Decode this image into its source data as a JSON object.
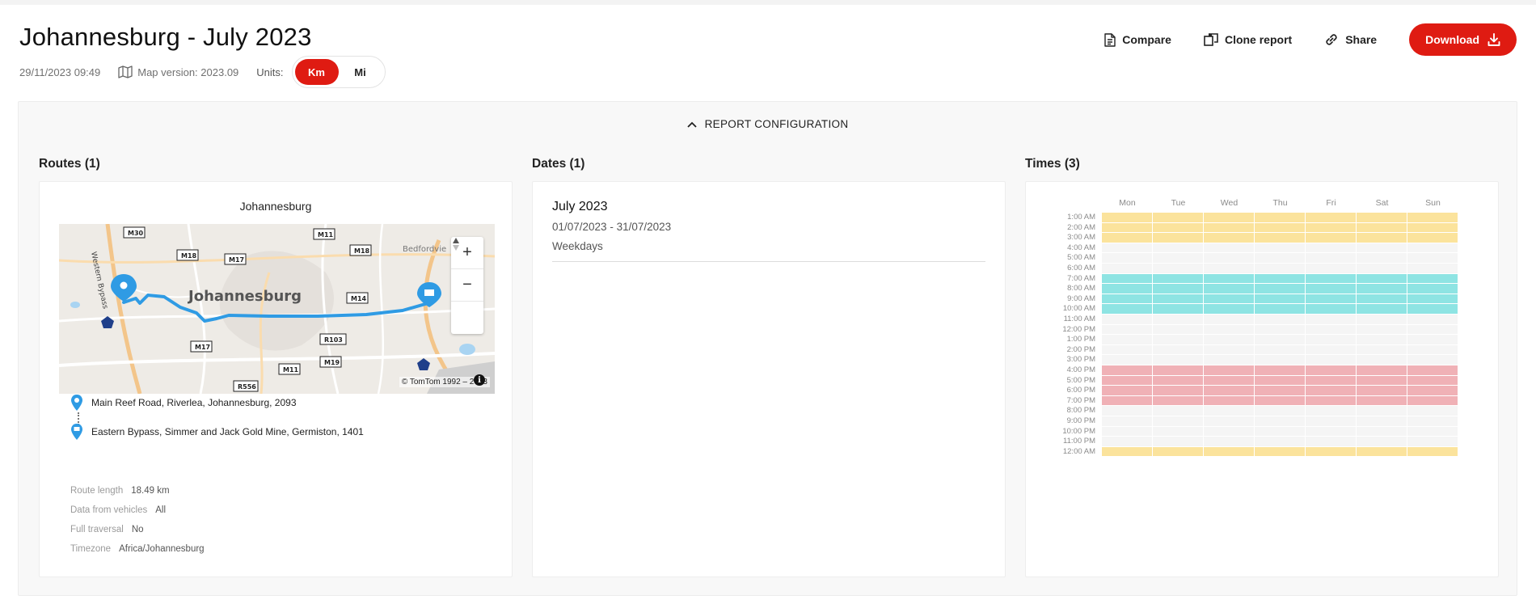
{
  "report": {
    "title": "Johannesburg - July 2023",
    "timestamp": "29/11/2023 09:49",
    "map_version": "Map version: 2023.09",
    "units_label": "Units:",
    "units": [
      {
        "label": "Km",
        "active": true
      },
      {
        "label": "Mi",
        "active": false
      }
    ]
  },
  "actions": {
    "compare": "Compare",
    "clone": "Clone report",
    "share": "Share",
    "download": "Download"
  },
  "config": {
    "toggle_label": "REPORT CONFIGURATION",
    "routes_title": "Routes (1)",
    "dates_title": "Dates (1)",
    "times_title": "Times (3)"
  },
  "route": {
    "name": "Johannesburg",
    "start": "Main Reef Road, Riverlea, Johannesburg, 2093",
    "end": "Eastern Bypass, Simmer and Jack Gold Mine, Germiston, 1401",
    "details": [
      {
        "label": "Route length",
        "value": "18.49 km"
      },
      {
        "label": "Data from vehicles",
        "value": "All"
      },
      {
        "label": "Full traversal",
        "value": "No"
      },
      {
        "label": "Timezone",
        "value": "Africa/Johannesburg"
      }
    ],
    "map": {
      "city_label": "Johannesburg",
      "suburb_label": "Bedfordvie",
      "road_shields": [
        "M30",
        "M11",
        "M18",
        "M17",
        "M18",
        "M14",
        "R103",
        "M17",
        "M19",
        "M11",
        "R556"
      ],
      "street_label": "Western Bypass",
      "copyright": "© TomTom 1992 – 2023",
      "zoom_in": "+",
      "zoom_out": "−"
    }
  },
  "date": {
    "title": "July 2023",
    "range": "01/07/2023 - 31/07/2023",
    "type": "Weekdays"
  },
  "times": {
    "days": [
      "Mon",
      "Tue",
      "Wed",
      "Thu",
      "Fri",
      "Sat",
      "Sun"
    ],
    "hours": [
      "1:00 AM",
      "2:00 AM",
      "3:00 AM",
      "4:00 AM",
      "5:00 AM",
      "6:00 AM",
      "7:00 AM",
      "8:00 AM",
      "9:00 AM",
      "10:00 AM",
      "11:00 AM",
      "12:00 PM",
      "1:00 PM",
      "2:00 PM",
      "3:00 PM",
      "4:00 PM",
      "5:00 PM",
      "6:00 PM",
      "7:00 PM",
      "8:00 PM",
      "9:00 PM",
      "10:00 PM",
      "11:00 PM",
      "12:00 AM"
    ],
    "selection": [
      "yellow",
      "yellow",
      "yellow",
      "",
      "",
      "",
      "cyan",
      "cyan",
      "cyan",
      "cyan",
      "",
      "",
      "",
      "",
      "",
      "pink",
      "pink",
      "pink",
      "pink",
      "",
      "",
      "",
      "",
      "yellow"
    ],
    "colors": {
      "yellow": "#fbe39c",
      "cyan": "#8ee4e3",
      "pink": "#f0b1b6"
    }
  },
  "theme": {
    "accent": "#df1b12",
    "route_line": "#2f9be4"
  }
}
